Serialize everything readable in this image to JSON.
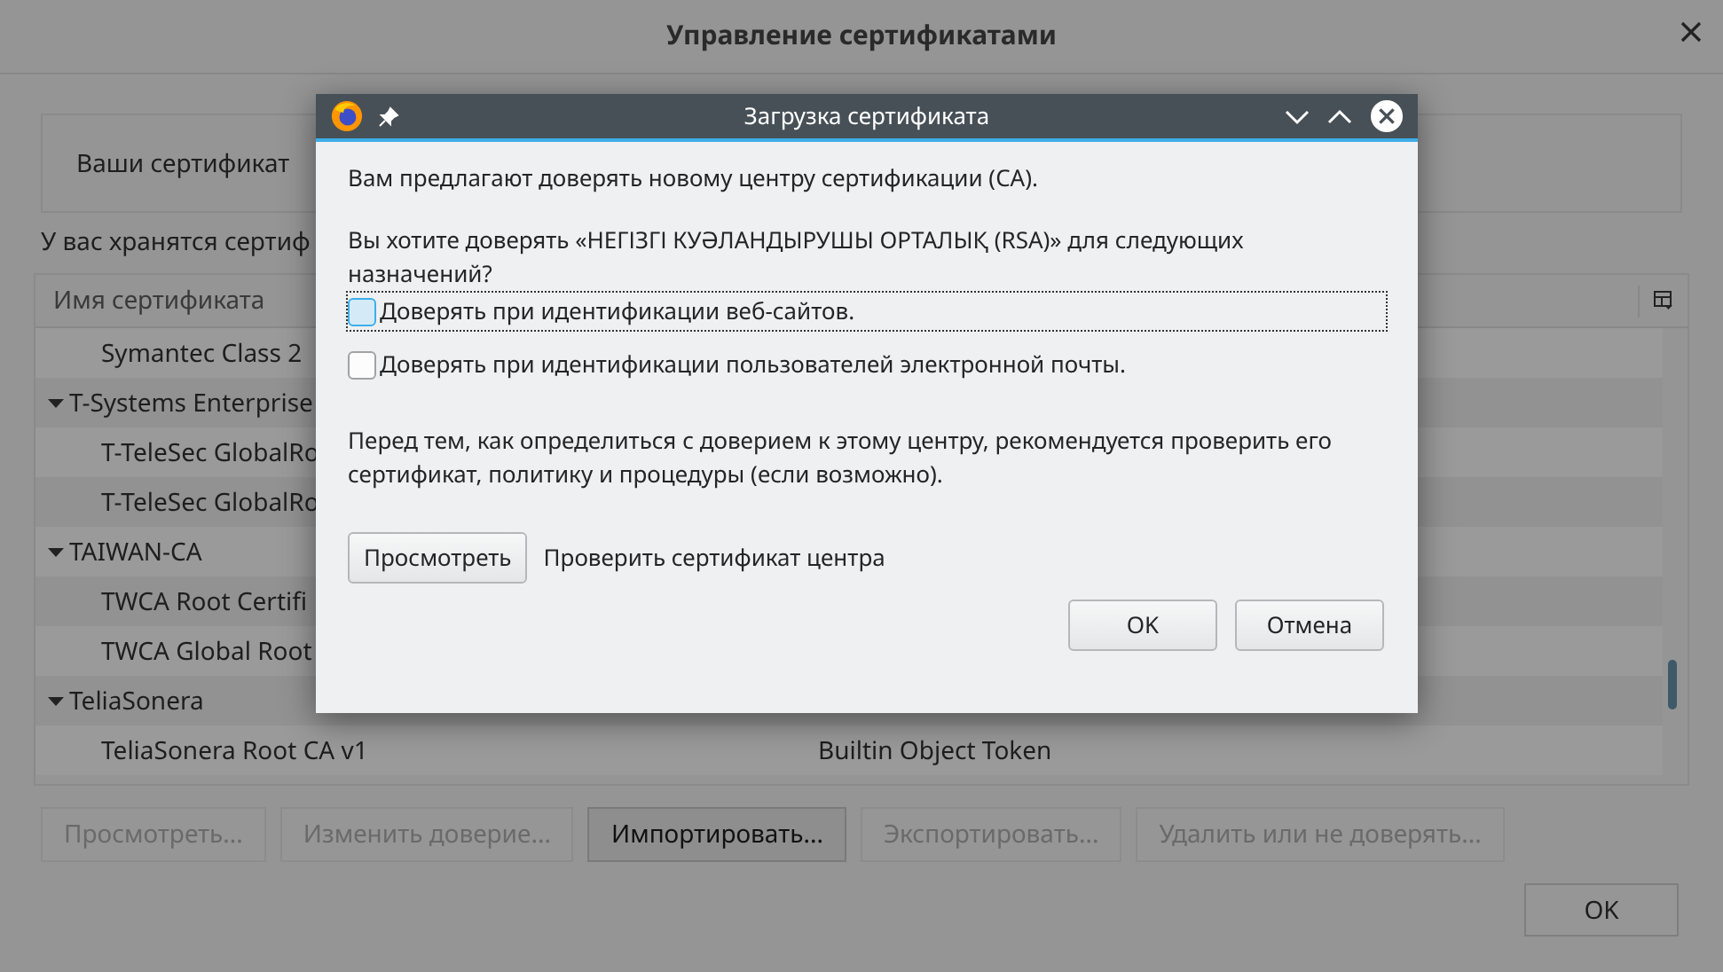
{
  "window": {
    "title": "Управление сертификатами"
  },
  "tab": {
    "label": "Ваши сертификат"
  },
  "description": "У вас хранятся сертиф",
  "table": {
    "columns": [
      "Имя сертификата"
    ],
    "tree": [
      {
        "children": [
          {
            "name": "Symantec Class 2"
          }
        ]
      },
      {
        "name": "T-Systems Enterprise",
        "expanded": true,
        "children": [
          {
            "name": "T-TeleSec GlobalRo"
          },
          {
            "name": "T-TeleSec GlobalRo"
          }
        ]
      },
      {
        "name": "TAIWAN-CA",
        "expanded": true,
        "children": [
          {
            "name": "TWCA Root Certifi"
          },
          {
            "name": "TWCA Global Root"
          }
        ]
      },
      {
        "name": "TeliaSonera",
        "expanded": true,
        "children": [
          {
            "name": "TeliaSonera Root CA v1",
            "token": "Builtin Object Token"
          }
        ]
      }
    ]
  },
  "buttons": [
    {
      "label": "Просмотреть...",
      "disabled": true
    },
    {
      "label": "Изменить доверие...",
      "disabled": true
    },
    {
      "label": "Импортировать...",
      "disabled": false
    },
    {
      "label": "Экспортировать...",
      "disabled": true
    },
    {
      "label": "Удалить или не доверять...",
      "disabled": true
    }
  ],
  "ok_button": "OK",
  "dialog": {
    "title": "Загрузка сертификата",
    "message": "Вам предлагают доверять новому центру сертификации (CA).",
    "question": "Вы хотите доверять «НЕГІЗГІ КУӘЛАНДЫРУШЫ ОРТАЛЫҚ (RSA)» для следующих назначений?",
    "options": [
      {
        "label": "Доверять при идентификации веб-сайтов.",
        "checked": false,
        "hovered": true,
        "focused": true
      },
      {
        "label": "Доверять при идентификации пользователей электронной почты.",
        "checked": false,
        "hovered": false,
        "focused": false
      }
    ],
    "note": "Перед тем, как определиться с доверием к этому центру, рекомендуется проверить его сертификат, политику и процедуры (если возможно).",
    "view_button": "Просмотреть",
    "view_hint": "Проверить сертификат центра",
    "buttons": [
      "OK",
      "Отмена"
    ]
  }
}
